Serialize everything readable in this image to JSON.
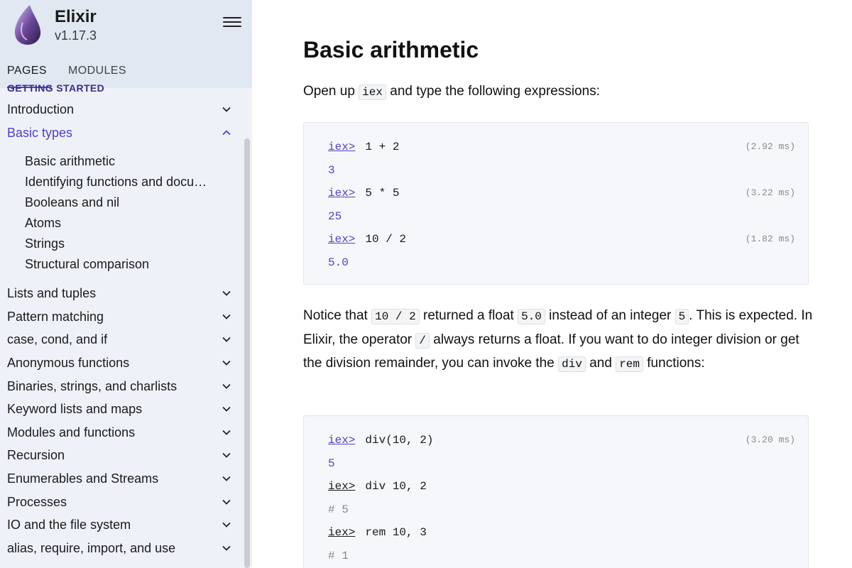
{
  "app": {
    "name": "Elixir",
    "version": "v1.17.3"
  },
  "tabs": [
    {
      "label": "PAGES"
    },
    {
      "label": "MODULES"
    }
  ],
  "sidebar": {
    "section": "GETTING STARTED",
    "items": [
      {
        "label": "Introduction"
      },
      {
        "label": "Basic types"
      },
      {
        "label": "Lists and tuples"
      },
      {
        "label": "Pattern matching"
      },
      {
        "label": "case, cond, and if"
      },
      {
        "label": "Anonymous functions"
      },
      {
        "label": "Binaries, strings, and charlists"
      },
      {
        "label": "Keyword lists and maps"
      },
      {
        "label": "Modules and functions"
      },
      {
        "label": "Recursion"
      },
      {
        "label": "Enumerables and Streams"
      },
      {
        "label": "Processes"
      },
      {
        "label": "IO and the file system"
      },
      {
        "label": "alias, require, import, and use"
      }
    ],
    "subitems": [
      {
        "label": "Basic arithmetic"
      },
      {
        "label": "Identifying functions and documentation"
      },
      {
        "label": "Booleans and nil"
      },
      {
        "label": "Atoms"
      },
      {
        "label": "Strings"
      },
      {
        "label": "Structural comparison"
      }
    ]
  },
  "main": {
    "title": "Basic arithmetic",
    "intro": {
      "before": "Open up ",
      "code": "iex",
      "after": " and type the following expressions:"
    },
    "block1": [
      {
        "prompt": "iex>",
        "cmd": "1 + 2",
        "time": "(2.92 ms)"
      },
      {
        "result": "3"
      },
      {
        "prompt": "iex>",
        "cmd": "5 * 5",
        "time": "(3.22 ms)"
      },
      {
        "result": "25"
      },
      {
        "prompt": "iex>",
        "cmd": "10 / 2",
        "time": "(1.82 ms)"
      },
      {
        "result": "5.0"
      }
    ],
    "notice": {
      "t1": "Notice that ",
      "c1": "10 / 2",
      "t2": " returned a float ",
      "c2": "5.0",
      "t3": " instead of an integer ",
      "c3": "5",
      "t4": ". This is expected. In Elixir, the operator ",
      "c4": "/",
      "t5": " always returns a float. If you want to do integer division or get the division remainder, you can invoke the ",
      "c5": "div",
      "t6": " and ",
      "c6": "rem",
      "t7": " functions:"
    },
    "block2": [
      {
        "prompt": "iex>",
        "cmd": "div(10, 2)",
        "time": "(3.20 ms)"
      },
      {
        "result": "5"
      },
      {
        "prompt": "iex>",
        "cmd": "div 10, 2"
      },
      {
        "comment": "# 5"
      },
      {
        "prompt": "iex>",
        "cmd": "rem 10, 3"
      },
      {
        "comment": "# 1"
      }
    ]
  },
  "colors": {
    "accent": "#5142c7",
    "sidebar_bg": "#eef2f8",
    "header_bg": "#e1e8f2"
  },
  "icons": {
    "logo": "elixir-drop-logo",
    "menu": "hamburger-icon",
    "chevron_down": "chevron-down-icon",
    "chevron_up": "chevron-up-icon"
  }
}
